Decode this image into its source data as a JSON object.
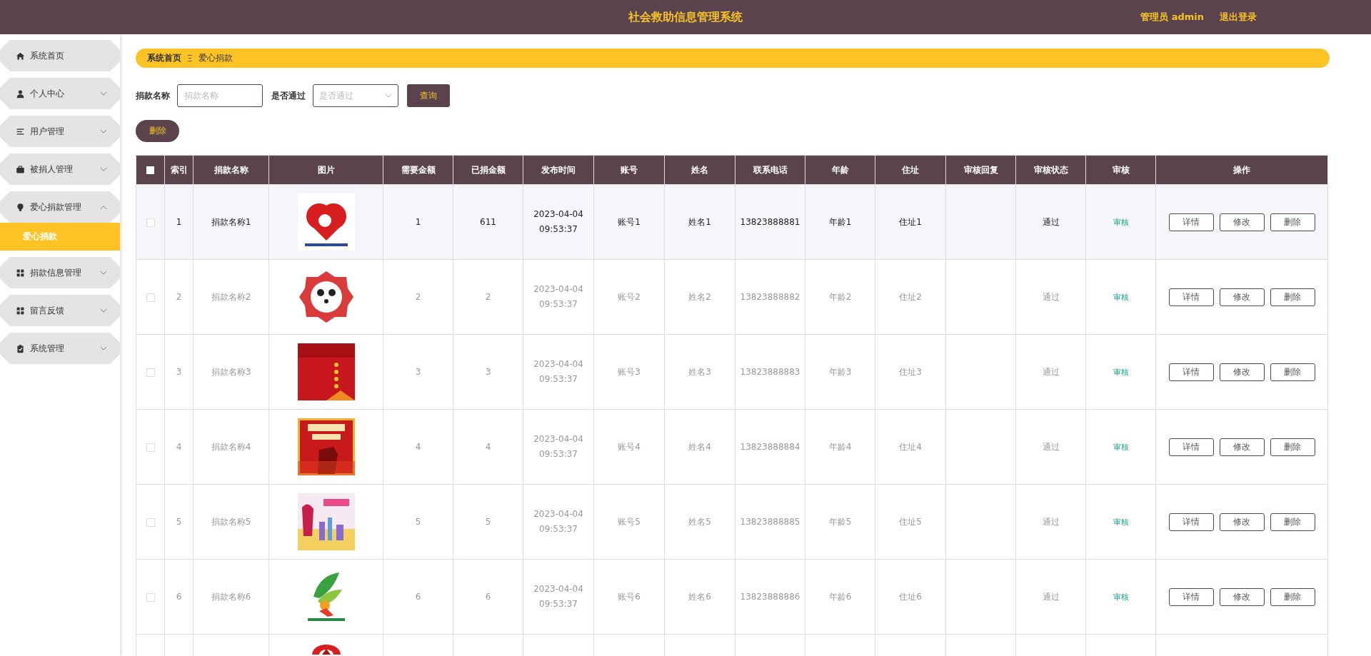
{
  "header": {
    "title": "社会救助信息管理系统",
    "user": "管理员 admin",
    "logout": "退出登录"
  },
  "sidebar": {
    "items": [
      {
        "label": "系统首页",
        "kind": "home"
      },
      {
        "label": "个人中心",
        "kind": "person",
        "expanded": false
      },
      {
        "label": "用户管理",
        "kind": "list",
        "expanded": false
      },
      {
        "label": "被捐人管理",
        "kind": "briefcase",
        "expanded": false
      },
      {
        "label": "爱心捐款管理",
        "kind": "bulb",
        "expanded": true,
        "children": [
          {
            "label": "爱心捐款",
            "selected": true
          }
        ]
      },
      {
        "label": "捐款信息管理",
        "kind": "grid",
        "expanded": false
      },
      {
        "label": "留言反馈",
        "kind": "grid",
        "expanded": false
      },
      {
        "label": "系统管理",
        "kind": "clipboard",
        "expanded": false
      }
    ]
  },
  "breadcrumb": {
    "home": "系统首页",
    "separator": "Ξ",
    "current": "爱心捐款"
  },
  "filters": [
    {
      "label": "捐款名称",
      "kind": "text",
      "placeholder": "捐款名称"
    },
    {
      "label": "是否通过",
      "kind": "select",
      "placeholder": "是否通过"
    }
  ],
  "search_button": "查询",
  "delete_button": "删除",
  "table": {
    "select_all": {
      "checked": false
    },
    "columns": [
      "索引",
      "捐款名称",
      "图片",
      "需要金额",
      "已捐金额",
      "发布时间",
      "账号",
      "姓名",
      "联系电话",
      "年龄",
      "住址",
      "审核回复",
      "审核状态",
      "审核",
      "操作"
    ],
    "rows": [
      {
        "checked": false,
        "highlighted": true,
        "cells": [
          "1",
          "捐款名称1",
          "",
          "1",
          "611",
          "2023-04-04 09:53:37",
          "账号1",
          "姓名1",
          "13823888881",
          "年龄1",
          "住址1",
          "",
          "通过"
        ],
        "audit": "审核",
        "actions": [
          "详情",
          "修改",
          "删除"
        ]
      },
      {
        "checked": false,
        "highlighted": false,
        "cells": [
          "2",
          "捐款名称2",
          "",
          "2",
          "2",
          "2023-04-04 09:53:37",
          "账号2",
          "姓名2",
          "13823888882",
          "年龄2",
          "住址2",
          "",
          "通过"
        ],
        "audit": "审核",
        "actions": [
          "详情",
          "修改",
          "删除"
        ]
      },
      {
        "checked": false,
        "highlighted": false,
        "cells": [
          "3",
          "捐款名称3",
          "",
          "3",
          "3",
          "2023-04-04 09:53:37",
          "账号3",
          "姓名3",
          "13823888883",
          "年龄3",
          "住址3",
          "",
          "通过"
        ],
        "audit": "审核",
        "actions": [
          "详情",
          "修改",
          "删除"
        ]
      },
      {
        "checked": false,
        "highlighted": false,
        "cells": [
          "4",
          "捐款名称4",
          "",
          "4",
          "4",
          "2023-04-04 09:53:37",
          "账号4",
          "姓名4",
          "13823888884",
          "年龄4",
          "住址4",
          "",
          "通过"
        ],
        "audit": "审核",
        "actions": [
          "详情",
          "修改",
          "删除"
        ]
      },
      {
        "checked": false,
        "highlighted": false,
        "cells": [
          "5",
          "捐款名称5",
          "",
          "5",
          "5",
          "2023-04-04 09:53:37",
          "账号5",
          "姓名5",
          "13823888885",
          "年龄5",
          "住址5",
          "",
          "通过"
        ],
        "audit": "审核",
        "actions": [
          "详情",
          "修改",
          "删除"
        ]
      },
      {
        "checked": false,
        "highlighted": false,
        "cells": [
          "6",
          "捐款名称6",
          "",
          "6",
          "6",
          "2023-04-04 09:53:37",
          "账号6",
          "姓名6",
          "13823888886",
          "年龄6",
          "住址6",
          "",
          "通过"
        ],
        "audit": "审核",
        "actions": [
          "详情",
          "修改",
          "删除"
        ]
      }
    ]
  }
}
